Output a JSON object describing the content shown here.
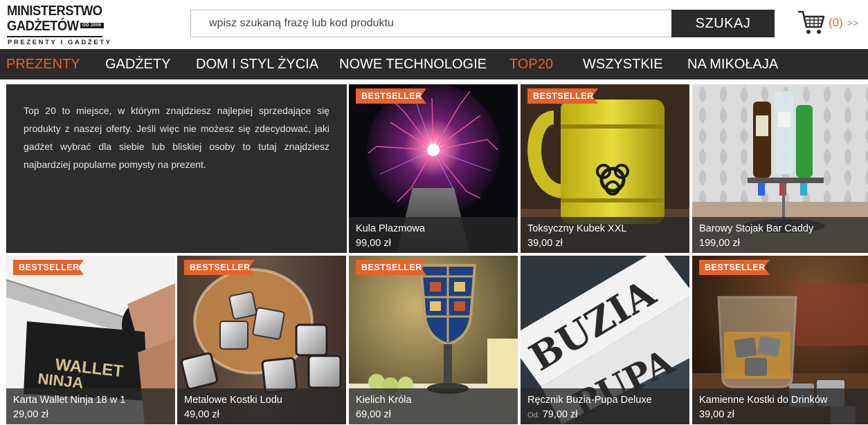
{
  "logo": {
    "line1": "MINISTERSTWO",
    "line2": "GADŻETÓW",
    "since": "OD 2006",
    "tagline": "PREZENTY I GADŻETY"
  },
  "search": {
    "placeholder": "wpisz szukaną frazę lub kod produktu",
    "value": "",
    "button_label": "SZUKAJ"
  },
  "cart": {
    "icon": "cart-icon",
    "count": "(0)",
    "more": ">>"
  },
  "colors": {
    "accent": "#e7612a",
    "dark": "#2b2b2b"
  },
  "nav": [
    {
      "label": "PREZENTY",
      "accent": true
    },
    {
      "label": "GADŻETY",
      "accent": false
    },
    {
      "label": "DOM I STYL ŻYCIA",
      "accent": false
    },
    {
      "label": "NOWE TECHNOLOGIE",
      "accent": false
    },
    {
      "label": "TOP20",
      "accent": true
    },
    {
      "label": "WSZYSTKIE",
      "accent": false
    },
    {
      "label": "NA MIKOŁAJA",
      "accent": false
    }
  ],
  "intro": {
    "text": "Top 20 to miejsce, w którym znajdziesz najlepiej sprzedające się produkty z naszej oferty. Jeśli więc nie możesz się zdecydować, jaki gadżet wybrać dla siebie lub bliskiej osoby to tutaj znajdziesz najbardziej popularne pomysty na prezent."
  },
  "badge_label": "BESTSELLER",
  "products": [
    {
      "name": "Kula Plazmowa",
      "price": "99,00 zł",
      "bestseller": true
    },
    {
      "name": "Toksyczny Kubek XXL",
      "price": "39,00 zł",
      "bestseller": true
    },
    {
      "name": "Barowy Stojak Bar Caddy",
      "price": "199,00 zł",
      "bestseller": false
    },
    {
      "name": "Karta Wallet Ninja 18 w 1",
      "price": "29,00 zł",
      "bestseller": true
    },
    {
      "name": "Metalowe Kostki Lodu",
      "price": "49,00 zł",
      "bestseller": true
    },
    {
      "name": "Kielich Króla",
      "price": "69,00 zł",
      "bestseller": true
    },
    {
      "name": "Ręcznik Buzia-Pupa Deluxe",
      "price_prefix": "Od:",
      "price": "79,00 zł",
      "bestseller": false
    },
    {
      "name": "Kamienne Kostki do Drinków",
      "price": "39,00 zł",
      "bestseller": true
    }
  ]
}
